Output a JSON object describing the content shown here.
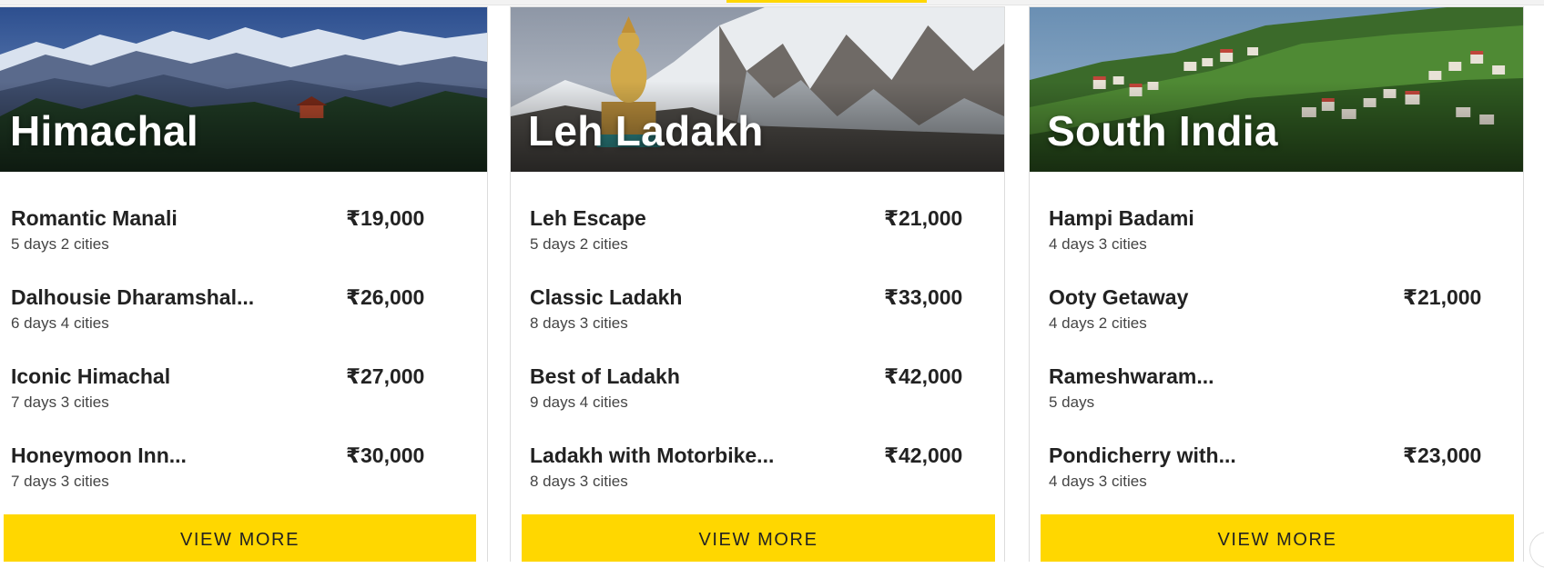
{
  "cards": [
    {
      "title": "Himachal",
      "packages": [
        {
          "name": "Romantic Manali",
          "meta": "5 days 2 cities",
          "price": "₹19,000"
        },
        {
          "name": "Dalhousie Dharamshal...",
          "meta": "6 days 4 cities",
          "price": "₹26,000"
        },
        {
          "name": "Iconic Himachal",
          "meta": "7 days 3 cities",
          "price": "₹27,000"
        },
        {
          "name": "Honeymoon Inn...",
          "meta": "7 days 3 cities",
          "price": "₹30,000"
        }
      ],
      "button_label": "VIEW MORE"
    },
    {
      "title": "Leh Ladakh",
      "packages": [
        {
          "name": "Leh Escape",
          "meta": "5 days 2 cities",
          "price": "₹21,000"
        },
        {
          "name": "Classic Ladakh",
          "meta": "8 days 3 cities",
          "price": "₹33,000"
        },
        {
          "name": "Best of Ladakh",
          "meta": "9 days 4 cities",
          "price": "₹42,000"
        },
        {
          "name": "Ladakh with Motorbike...",
          "meta": "8 days 3 cities",
          "price": "₹42,000"
        }
      ],
      "button_label": "VIEW MORE"
    },
    {
      "title": "South India",
      "packages": [
        {
          "name": "Hampi Badami",
          "meta": "4 days 3 cities",
          "price": ""
        },
        {
          "name": "Ooty Getaway",
          "meta": "4 days 2 cities",
          "price": "₹21,000"
        },
        {
          "name": "Rameshwaram...",
          "meta": "5 days",
          "price": ""
        },
        {
          "name": "Pondicherry with...",
          "meta": "4 days 3 cities",
          "price": "₹23,000"
        }
      ],
      "button_label": "VIEW MORE"
    }
  ],
  "colors": {
    "accent": "#ffd700",
    "text": "#222222",
    "muted": "#444444"
  }
}
